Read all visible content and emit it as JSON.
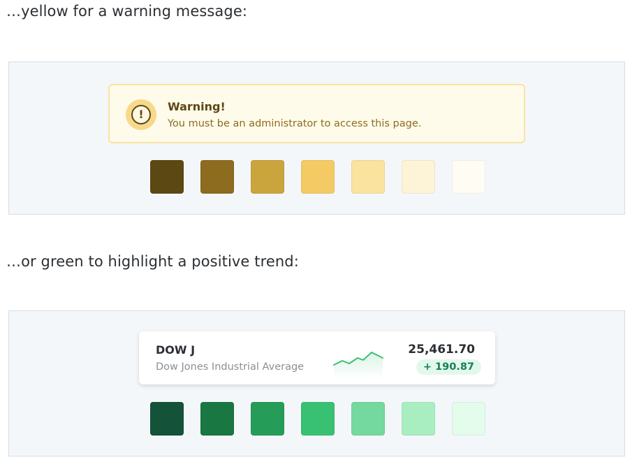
{
  "captions": {
    "yellow": "…yellow for a warning message:",
    "green": "…or green to highlight a positive trend:"
  },
  "warning": {
    "icon": "exclamation-circle-icon",
    "icon_glyph": "!",
    "title": "Warning!",
    "message": "You must be an administrator to access this page."
  },
  "yellow_palette": [
    "#5c4813",
    "#8d6b1f",
    "#caa53d",
    "#f4ca64",
    "#fae29f",
    "#fdf3d7",
    "#fffcf4"
  ],
  "stock": {
    "ticker": "DOW J",
    "name": "Dow Jones Industrial Average",
    "price": "25,461.70",
    "change": "+ 190.87",
    "trend_icon": "sparkline-chart",
    "accent_color": "#3cb371"
  },
  "green_palette": [
    "#145239",
    "#197741",
    "#259d58",
    "#38c172",
    "#74d99f",
    "#a8eec1",
    "#e3fcec"
  ]
}
